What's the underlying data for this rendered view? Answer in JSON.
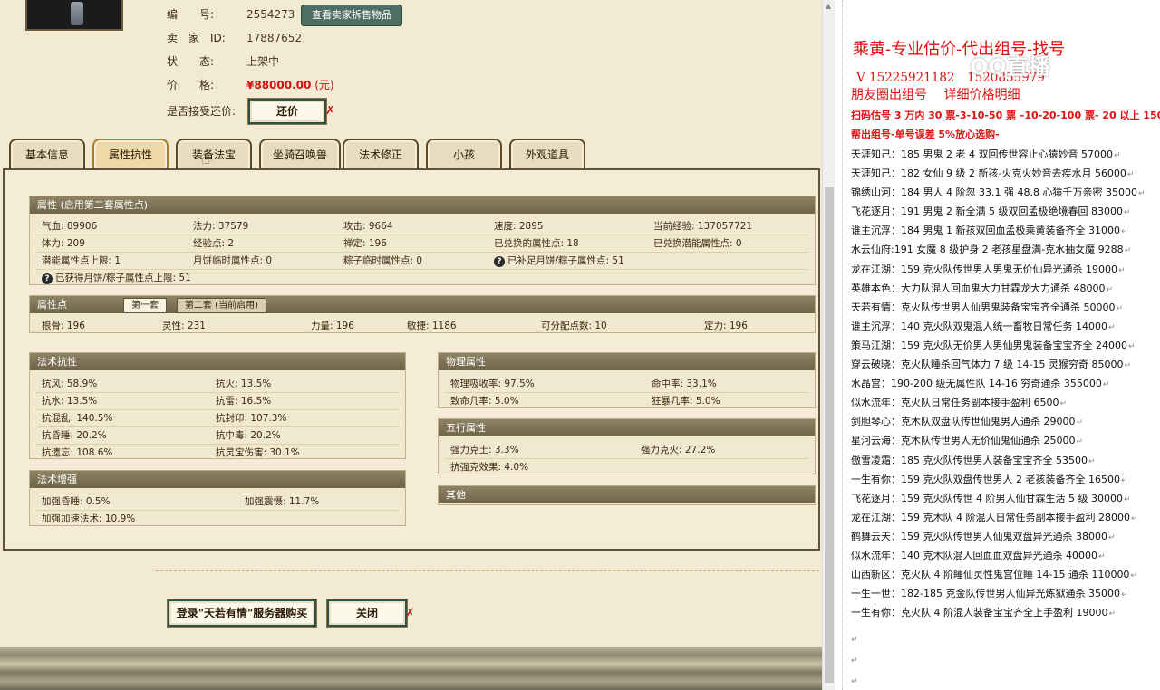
{
  "seller": {
    "number_label": "编　　号:",
    "number_value": "2554273",
    "view_items_button": "查看卖家拆售物品",
    "id_label": "卖　家　ID:",
    "id_value": "17887652",
    "status_label": "状　　态:",
    "status_value": "上架中",
    "price_label": "价　　格:",
    "price_value": "¥88000.00",
    "price_unit": "(元)",
    "bargain_label": "是否接受还价:",
    "bargain_button": "还价"
  },
  "tabs": [
    {
      "label": "基本信息"
    },
    {
      "label": "属性抗性"
    },
    {
      "label": "装备法宝"
    },
    {
      "label": "坐骑召唤兽"
    },
    {
      "label": "法术修正"
    },
    {
      "label": "小孩"
    },
    {
      "label": "外观道具"
    }
  ],
  "attributes": {
    "header": "属性 (启用第二套属性点)",
    "row1": [
      "气血: 89906",
      "法力: 37579",
      "攻击: 9664",
      "速度: 2895",
      "当前经验: 137057721"
    ],
    "row2": [
      "体力: 209",
      "经验点: 2",
      "禅定: 196",
      "已兑换的属性点: 18",
      "已兑换潜能属性点: 0"
    ],
    "row3": [
      "潜能属性点上限: 1",
      "月饼临时属性点: 0",
      "粽子临时属性点: 0",
      "已补足月饼/粽子属性点: 51"
    ],
    "row4": "已获得月饼/粽子属性点上限: 51",
    "q_mark": "?"
  },
  "points": {
    "header": "属性点",
    "tab1": "第一套",
    "tab2": "第二套 (当前启用)",
    "values": [
      "根骨: 196",
      "灵性: 231",
      "力量: 196",
      "敏捷: 1186",
      "可分配点数: 10",
      "定力: 196"
    ]
  },
  "resist": {
    "header": "法术抗性",
    "items": [
      "抗风: 58.9%",
      "抗火: 13.5%",
      "抗水: 13.5%",
      "抗雷: 16.5%",
      "抗混乱: 140.5%",
      "抗封印: 107.3%",
      "抗昏睡: 20.2%",
      "抗中毒: 20.2%",
      "抗遗忘: 108.6%",
      "抗灵宝伤害: 30.1%"
    ]
  },
  "enhance": {
    "header": "法术增强",
    "items": [
      "加强昏睡: 0.5%",
      "加强震慑: 11.7%",
      "加强加速法术: 10.9%"
    ]
  },
  "physical": {
    "header": "物理属性",
    "items": [
      "物理吸收率: 97.5%",
      "命中率: 33.1%",
      "致命几率: 5.0%",
      "狂暴几率: 5.0%"
    ]
  },
  "elements": {
    "header": "五行属性",
    "items": [
      "强力克土: 3.3%",
      "强力克火: 27.2%",
      "抗强克效果: 4.0%"
    ]
  },
  "other": {
    "header": "其他"
  },
  "bottom_buttons": {
    "login": "登录\"天若有情\"服务器购买",
    "close": "关闭"
  },
  "doc": {
    "title": "乘黄-专业估价-代出组号-找号",
    "phone": "V 15225921182　1520855979",
    "friends": "朋友圈出组号　 详细价格明细",
    "promo1": "扫码估号 3 万内 30 票-3-10-50 票 –10-20-100 票- 20 以上 150",
    "promo2": "帮出组号-单号误差 5%放心选购-",
    "listings": [
      "天涯知己：185 男鬼 2 老 4 双回传世容止心猿妙音 57000",
      "天涯知己：182 女仙 9 级 2 新孩-火克火妙音去疾水月 56000",
      "锦绣山河：184 男人 4 阶忽 33.1 强 48.8 心猿千万亲密 35000",
      "飞花逐月：191 男鬼 2 新全满 5 级双回孟极绝境春回 83000",
      "谁主沉浮：184 男鬼 1 新孩双回血孟极乘黄装备齐全 31000",
      "水云仙府:191 女魔 8 级护身 2 老孩星盘满-克水抽女魔 9288",
      "龙在江湖：159 克火队传世男人男鬼无价仙异光通杀 19000",
      "英雄本色：大力队混人回血鬼大力甘霖龙大力通杀 48000",
      "天若有情：克火队传世男人仙男鬼装备宝宝齐全通杀 50000",
      "谁主沉浮：140 克火队双鬼混人统一畜牧日常任务 14000",
      "策马江湖：159 克火队无价男人男仙男鬼装备宝宝齐全 24000",
      "穿云破晓：克火队睡杀回气体力 7 级 14-15 灵猴穷奇 85000",
      "水晶宫：190-200 级无属性队 14-16 穷奇通杀 355000",
      "似水流年：克火队日常任务副本接手盈利 6500",
      "剑胆琴心：克木队双盘队传世仙鬼男人通杀 29000",
      "星河云海：克木队传世男人无价仙鬼仙通杀 25000",
      "傲雪凌霜：185 克火队传世男人装备宝宝齐全 53500",
      "一生有你：159 克火队双盘传世男人 2 老孩装备齐全 16500",
      "飞花逐月：159 克火队传世 4 阶男人仙甘霖生活 5 级 30000",
      "龙在江湖：159 克木队 4 阶混人日常任务副本接手盈利 28000",
      "鹤舞云天：159 克火队传世男人仙鬼双盘异光通杀 38000",
      "似水流年：140 克木队混人回血血双盘异光通杀 40000",
      "山西新区：克火队 4 阶睡仙灵性鬼宫位睡 14-15 通杀 110000",
      "一生一世：182-185 克金队传世男人仙异光炼狱通杀 35000",
      "一生有你：克火队 4 阶混人装备宝宝齐全上手盈利 19000"
    ],
    "para_mark": "↵"
  },
  "watermark": "QQ直播"
}
